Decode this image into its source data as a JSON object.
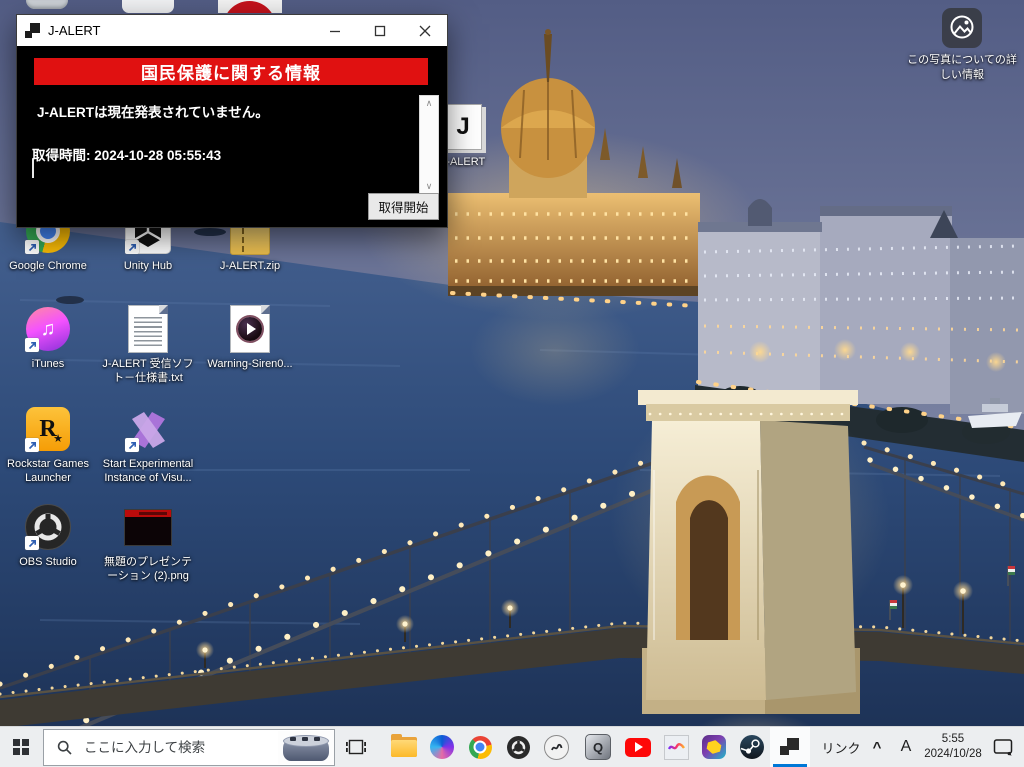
{
  "colors": {
    "banner_red": "#e01111",
    "accent_blue": "#0078d7",
    "taskbar_bg": "#eceef0"
  },
  "window": {
    "title": "J-ALERT",
    "banner": "国民保護に関する情報",
    "message": "J-ALERTは現在発表されていません。",
    "time_line": "取得時間: 2024-10-28 05:55:43",
    "fetch_button": "取得開始",
    "scroll_up_glyph": "∧",
    "scroll_down_glyph": "∨"
  },
  "desktop": {
    "icons": [
      {
        "name": "google-chrome",
        "label": "Google Chrome"
      },
      {
        "name": "unity-hub",
        "label": "Unity Hub"
      },
      {
        "name": "jalert-zip",
        "label": "J-ALERT.zip"
      },
      {
        "name": "itunes",
        "label": "iTunes"
      },
      {
        "name": "jalert-spec-txt",
        "label": "J-ALERT 受信ソフト－仕様書.txt"
      },
      {
        "name": "warning-siren",
        "label": "Warning-Siren0..."
      },
      {
        "name": "rockstar-games-launcher",
        "label": "Rockstar Games Launcher"
      },
      {
        "name": "vs-experimental-instance",
        "label": "Start Experimental Instance of Visu..."
      },
      {
        "name": "obs-studio",
        "label": "OBS Studio"
      },
      {
        "name": "presentation-png",
        "label": "無題のプレゼンテーション (2).png"
      },
      {
        "name": "jalert-app",
        "label": "J-ALERT"
      }
    ],
    "spotlight_label": "この写真についての詳しい情報",
    "itunes_glyph": "♫",
    "rockstar_letter": "R",
    "rockstar_star": "★",
    "jdoc_letter": "J"
  },
  "taskbar": {
    "search_placeholder": "ここに入力して検索",
    "qapp_letter": "Q",
    "tray": {
      "link_label": "リンク",
      "chevron": "^",
      "ime": "A",
      "time": "5:55",
      "date": "2024/10/28"
    }
  }
}
